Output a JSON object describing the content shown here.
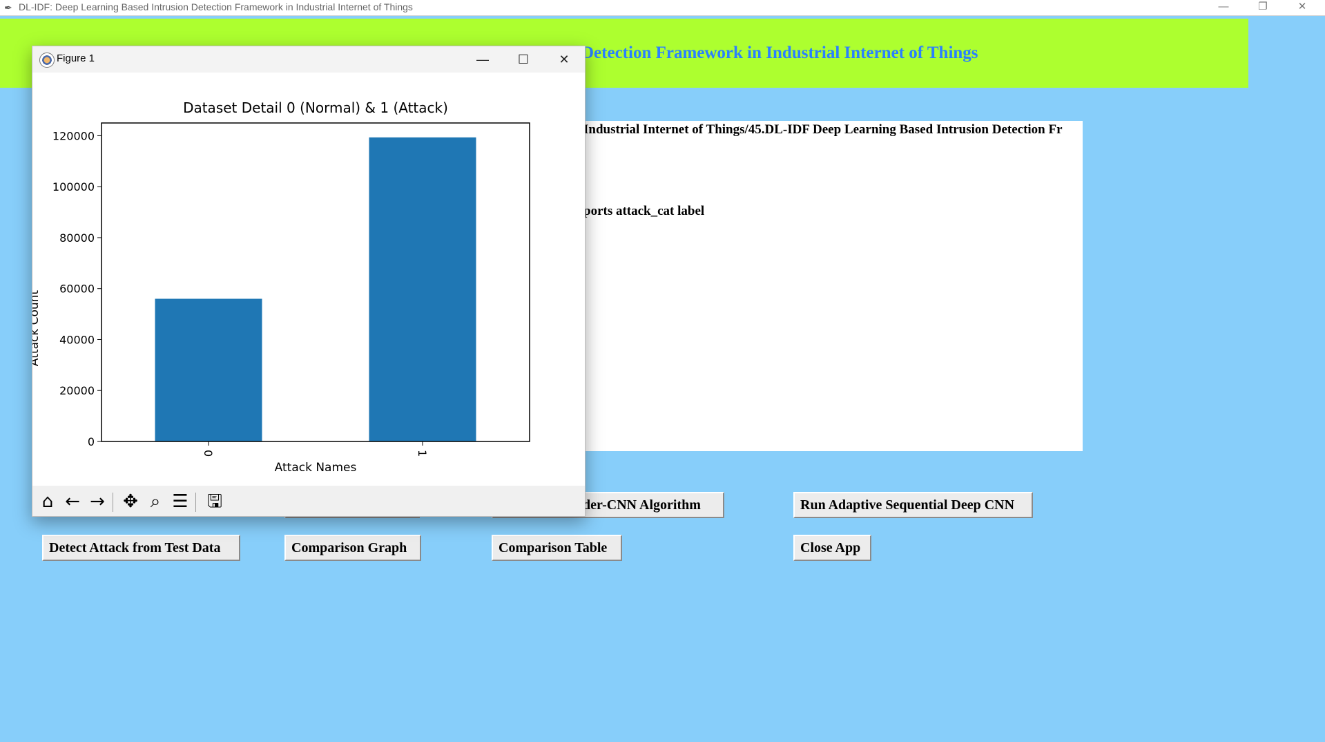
{
  "app": {
    "title": "DL-IDF: Deep Learning Based Intrusion Detection Framework in Industrial Internet of Things",
    "minimize": "—",
    "restore": "❐",
    "close": "✕"
  },
  "header": {
    "visible_title": "Detection Framework in Industrial Internet of Things",
    "background": "#adff2f",
    "title_color": "#2a7fff"
  },
  "text_area": {
    "line1": "Industrial Internet of Things/45.DL-IDF Deep Learning Based Intrusion Detection Fr",
    "line2": "ports  attack_cat  label"
  },
  "buttons": {
    "row1_hidden_1": "",
    "row1_hidden_2": "",
    "autoencoder_cnn": "oder-CNN Algorithm",
    "adaptive_cnn": "Run Adaptive Sequential Deep CNN",
    "detect_attack": "Detect Attack from Test Data",
    "comparison_graph": "Comparison Graph",
    "comparison_table": "Comparison Table",
    "close_app": "Close App"
  },
  "figure": {
    "title": "Figure 1",
    "minimize": "—",
    "maximize": "☐",
    "close": "✕",
    "toolbar": {
      "home": "home-icon",
      "back": "back-arrow-icon",
      "forward": "forward-arrow-icon",
      "pan": "pan-icon",
      "zoom": "zoom-icon",
      "configure": "configure-subplots-icon",
      "save": "save-icon"
    }
  },
  "chart_data": {
    "type": "bar",
    "title": "Dataset Detail 0 (Normal) & 1 (Attack)",
    "xlabel": "Attack Names",
    "ylabel": "Attack Count",
    "categories": [
      "0",
      "1"
    ],
    "values": [
      56000,
      119341
    ],
    "ylim": [
      0,
      125000
    ],
    "yticks": [
      0,
      20000,
      40000,
      60000,
      80000,
      100000,
      120000
    ],
    "bar_color": "#1f77b4",
    "grid": false
  }
}
